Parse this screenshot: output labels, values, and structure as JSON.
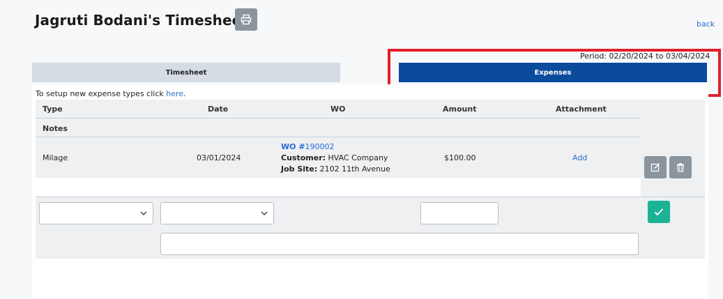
{
  "header": {
    "title": "Jagruti Bodani's Timesheet",
    "back_label": "back",
    "period_label": "Period: 02/20/2024 to 03/04/2024"
  },
  "tabs": [
    {
      "label": "Timesheet",
      "active": false
    },
    {
      "label": "Expenses",
      "active": true
    }
  ],
  "setup": {
    "text": "To setup new expense types click ",
    "link": "here",
    "suffix": "."
  },
  "table": {
    "columns": {
      "type": "Type",
      "date": "Date",
      "wo": "WO",
      "amount": "Amount",
      "attachment": "Attachment",
      "notes": "Notes"
    },
    "rows": [
      {
        "type": "Milage",
        "date": "03/01/2024",
        "wo_prefix": "WO #",
        "wo_number": "190002",
        "customer_label": "Customer:",
        "customer": " HVAC Company",
        "jobsite_label": "Job Site:",
        "jobsite": " 2102 11th Avenue",
        "amount": "$100.00",
        "attachment_action": "Add"
      }
    ]
  },
  "new_entry": {
    "type_value": "",
    "date_value": "",
    "amount_value": "",
    "notes_value": ""
  },
  "colors": {
    "active_tab": "#0a4b9c",
    "inactive_tab": "#d6dce3",
    "highlight": "#e0202a",
    "link": "#2a6bd1",
    "save": "#1ab394",
    "icon_button": "#8a959d"
  }
}
